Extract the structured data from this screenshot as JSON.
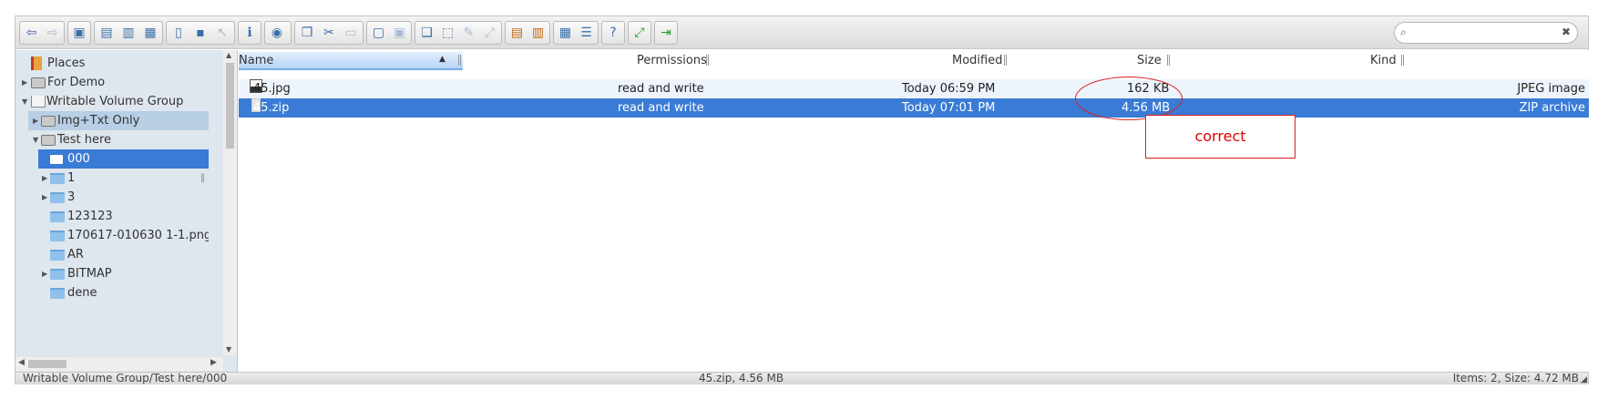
{
  "toolbar": {
    "search_value": "",
    "groups": [
      [
        "back-icon",
        "forward-icon"
      ],
      [
        "computer-icon"
      ],
      [
        "new-file-icon",
        "new-folder-icon",
        "save-icon"
      ],
      [
        "open-icon",
        "save-as-icon",
        "select-icon"
      ],
      [
        "info-icon"
      ],
      [
        "preview-icon"
      ],
      [
        "copy-icon",
        "cut-icon",
        "paste-icon"
      ],
      [
        "duplicate-icon",
        "delete-icon"
      ],
      [
        "rename-icon",
        "select-all-icon",
        "edit-icon",
        "resize-icon"
      ],
      [
        "archive-icon",
        "extract-icon"
      ],
      [
        "icons-view-icon",
        "list-view-icon"
      ],
      [
        "help-icon"
      ],
      [
        "fullscreen-icon"
      ],
      [
        "exit-icon"
      ]
    ]
  },
  "nav": {
    "items": [
      {
        "label": "Places",
        "icon": "places-icon"
      },
      {
        "label": "For Demo",
        "icon": "drive-icon"
      },
      {
        "label": "Writable Volume Group",
        "icon": "home-icon"
      },
      {
        "label": "Img+Txt Only",
        "icon": "drive-icon"
      },
      {
        "label": "Test here",
        "icon": "drive-icon"
      },
      {
        "label": "000",
        "icon": "folder-icon"
      },
      {
        "label": "1",
        "icon": "folder-icon"
      },
      {
        "label": "3",
        "icon": "folder-icon"
      },
      {
        "label": "123123",
        "icon": "folder-icon"
      },
      {
        "label": "170617-010630 1-1.png",
        "icon": "folder-icon"
      },
      {
        "label": "AR",
        "icon": "folder-icon"
      },
      {
        "label": "BITMAP",
        "icon": "folder-icon"
      },
      {
        "label": "dene",
        "icon": "folder-icon"
      }
    ]
  },
  "columns": {
    "name": "Name",
    "permissions": "Permissions",
    "modified": "Modified",
    "size": "Size",
    "kind": "Kind"
  },
  "files": [
    {
      "name": "45.jpg",
      "permissions": "read and write",
      "modified": "Today 06:59 PM",
      "size": "162 KB",
      "kind": "JPEG image",
      "icon": "image-file-icon"
    },
    {
      "name": "45.zip",
      "permissions": "read and write",
      "modified": "Today 07:01 PM",
      "size": "4.56 MB",
      "kind": "ZIP archive",
      "icon": "zip-file-icon"
    }
  ],
  "status": {
    "path": "Writable Volume Group/Test here/000",
    "selection": "45.zip, 4.56 MB",
    "summary": "Items: 2, Size: 4.72 MB"
  },
  "annotation": {
    "text": "correct",
    "color": "#e00000"
  },
  "colors": {
    "selection": "#3a7bd5",
    "sidebar_bg": "#dee6ee"
  }
}
